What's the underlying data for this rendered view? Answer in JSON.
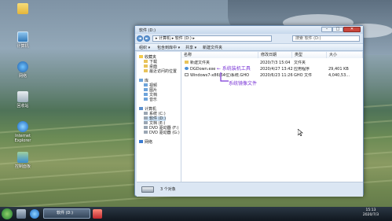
{
  "desktop": {
    "icons": [
      {
        "label": "",
        "icon": "folder-icon"
      },
      {
        "label": "计算机",
        "icon": "computer-icon"
      },
      {
        "label": "网络",
        "icon": "network-icon"
      },
      {
        "label": "回收站",
        "icon": "recycle-bin-icon"
      },
      {
        "label": "Internet Explorer",
        "icon": "internet-explorer-icon"
      },
      {
        "label": "控制面板",
        "icon": "control-panel-icon"
      }
    ]
  },
  "window": {
    "title": "软件 (D:)",
    "controls": {
      "minimize": "–",
      "maximize": "□",
      "close": "✕"
    },
    "nav": {
      "back": "◄",
      "forward": "►"
    },
    "address": "▸ 计算机 ▸ 软件 (D:) ▸",
    "search_placeholder": "搜索 软件 (D:)",
    "toolbar": [
      "组织 ▾",
      "包含到库中 ▾",
      "共享 ▾",
      "新建文件夹"
    ],
    "tree": [
      {
        "label": "收藏夹",
        "icon": "star-icon",
        "indent": 0
      },
      {
        "label": "下载",
        "icon": "folder-icon",
        "indent": 1
      },
      {
        "label": "桌面",
        "icon": "folder-icon",
        "indent": 1
      },
      {
        "label": "最近访问的位置",
        "icon": "folder-icon",
        "indent": 1
      },
      {
        "label": "库",
        "icon": "library-icon",
        "indent": 0
      },
      {
        "label": "视频",
        "icon": "library-icon",
        "indent": 1
      },
      {
        "label": "图片",
        "icon": "library-icon",
        "indent": 1
      },
      {
        "label": "文档",
        "icon": "library-icon",
        "indent": 1
      },
      {
        "label": "音乐",
        "icon": "library-icon",
        "indent": 1
      },
      {
        "label": "计算机",
        "icon": "computer-icon",
        "indent": 0
      },
      {
        "label": "系统 (C:)",
        "icon": "drive-icon",
        "indent": 1
      },
      {
        "label": "软件 (D:)",
        "icon": "drive-icon",
        "indent": 1,
        "selected": true
      },
      {
        "label": "文档 (E:)",
        "icon": "drive-icon",
        "indent": 1
      },
      {
        "label": "DVD 驱动器 (F:)",
        "icon": "dvd-icon",
        "indent": 1
      },
      {
        "label": "DVD 驱动器 (G:)",
        "icon": "dvd-icon",
        "indent": 1
      },
      {
        "label": "网络",
        "icon": "network-icon",
        "indent": 0
      }
    ],
    "columns": [
      "名称",
      "修改日期",
      "类型",
      "大小"
    ],
    "files": [
      {
        "name": "新建文件夹",
        "date": "2020/7/3 15:04",
        "type": "文件夹",
        "size": "",
        "icon": "folder"
      },
      {
        "name": "DGDown.exe",
        "date": "2020/4/27 13:42",
        "type": "应用程序",
        "size": "29,401 KB",
        "icon": "exe"
      },
      {
        "name": "Windows7-x86(64位)系统.GHO",
        "date": "2020/6/23 11:26",
        "type": "GHO 文件",
        "size": "4,040,53...",
        "icon": "gho"
      }
    ],
    "annotations": [
      "← 系统装机工具",
      "系统镜像文件"
    ],
    "status": "3 个对象"
  },
  "taskbar": {
    "task_label": "软件 (D:)",
    "time": "15:13",
    "date": "2020/7/3"
  }
}
